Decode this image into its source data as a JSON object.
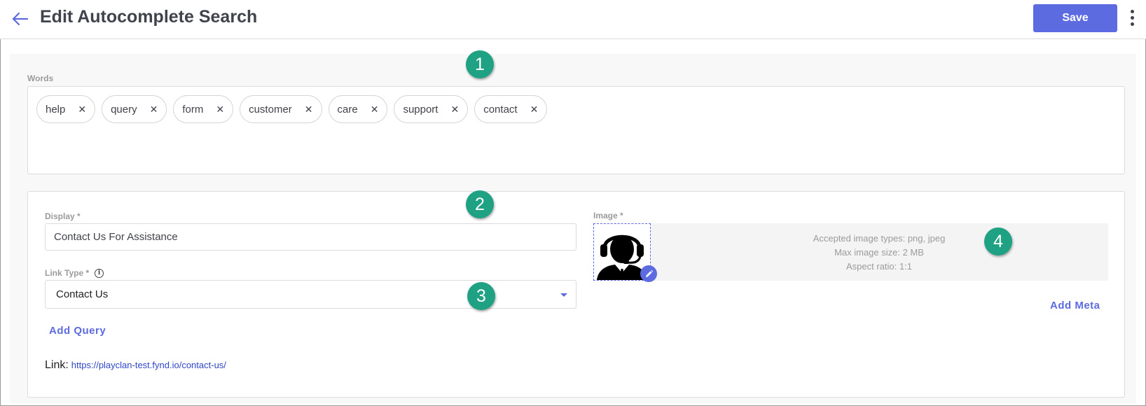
{
  "header": {
    "title": "Edit Autocomplete Search",
    "save_label": "Save"
  },
  "words": {
    "label": "Words",
    "chips": [
      "help",
      "query",
      "form",
      "customer",
      "care",
      "support",
      "contact"
    ]
  },
  "form": {
    "display_label": "Display *",
    "display_value": "Contact Us For Assistance",
    "link_type_label": "Link Type *",
    "link_type_value": "Contact Us",
    "add_query_label": "Add Query",
    "link_prefix": "Link:",
    "link_url": "https://playclan-test.fynd.io/contact-us/"
  },
  "image": {
    "label": "Image *",
    "info_types": "Accepted image types: png, jpeg",
    "info_size": "Max image size: 2 MB",
    "info_aspect": "Aspect ratio: 1:1",
    "add_meta_label": "Add Meta"
  },
  "callouts": [
    "1",
    "2",
    "3",
    "4"
  ],
  "colors": {
    "accent": "#5c6bdf",
    "callout": "#1fa184",
    "text": "#41434c",
    "muted": "#9b9b9b"
  },
  "icons": [
    "back-arrow-icon",
    "kebab-menu-icon",
    "close-icon",
    "info-icon",
    "caret-down-icon",
    "headset-user-icon",
    "edit-pencil-icon"
  ]
}
